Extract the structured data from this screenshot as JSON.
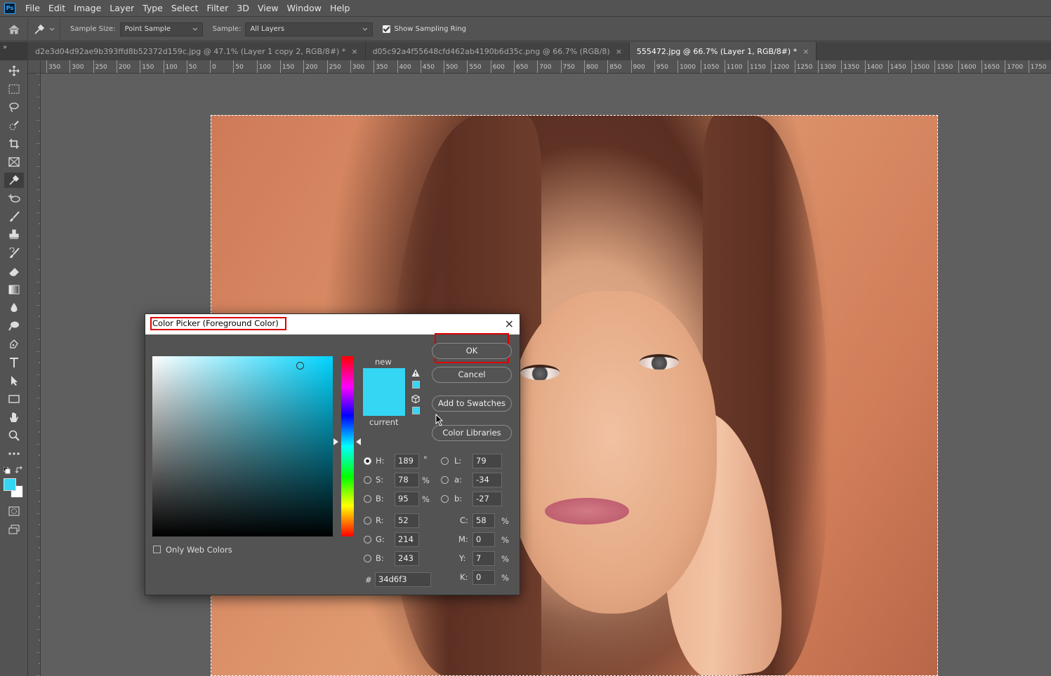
{
  "app": {
    "logo": "Ps"
  },
  "menu": [
    "File",
    "Edit",
    "Image",
    "Layer",
    "Type",
    "Select",
    "Filter",
    "3D",
    "View",
    "Window",
    "Help"
  ],
  "options": {
    "sample_size_label": "Sample Size:",
    "sample_size_value": "Point Sample",
    "sample_label": "Sample:",
    "sample_value": "All Layers",
    "show_ring_label": "Show Sampling Ring"
  },
  "tabs": {
    "collapse": "»",
    "items": [
      {
        "label": "d2e3d04d92ae9b393ffd8b52372d159c.jpg @ 47.1% (Layer 1 copy 2, RGB/8#) *",
        "close": "×"
      },
      {
        "label": "d05c92a4f55648cfd462ab4190b6d35c.png @ 66.7% (RGB/8)",
        "close": "×"
      },
      {
        "label": "555472.jpg @ 66.7% (Layer 1, RGB/8#) *",
        "close": "×"
      }
    ]
  },
  "ruler_top": [
    "350",
    "300",
    "250",
    "200",
    "150",
    "100",
    "50",
    "0",
    "50",
    "100",
    "150",
    "200",
    "250",
    "300",
    "350",
    "400",
    "450",
    "500",
    "550",
    "600",
    "650",
    "700",
    "750",
    "800",
    "850",
    "900",
    "950",
    "1000",
    "1050",
    "1100",
    "1150",
    "1200",
    "1250",
    "1300",
    "1350",
    "1400",
    "1450",
    "1500",
    "1550",
    "1600",
    "1650",
    "1700",
    "1750"
  ],
  "colors": {
    "foreground": "#34d6f3",
    "background": "#ffffff",
    "selected": "#34d6f3"
  },
  "dialog": {
    "title": "Color Picker (Foreground Color)",
    "close": "×",
    "new_label": "new",
    "current_label": "current",
    "buttons": {
      "ok": "OK",
      "cancel": "Cancel",
      "add_swatches": "Add to Swatches",
      "libraries": "Color Libraries"
    },
    "hsb": {
      "h_label": "H:",
      "h": "189",
      "h_unit": "°",
      "s_label": "S:",
      "s": "78",
      "s_unit": "%",
      "b_label": "B:",
      "b": "95",
      "b_unit": "%"
    },
    "lab": {
      "l_label": "L:",
      "l": "79",
      "a_label": "a:",
      "a": "-34",
      "b_label": "b:",
      "b": "-27"
    },
    "rgb": {
      "r_label": "R:",
      "r": "52",
      "g_label": "G:",
      "g": "214",
      "b_label": "B:",
      "b": "243"
    },
    "cmyk": {
      "c_label": "C:",
      "c": "58",
      "m_label": "M:",
      "m": "0",
      "y_label": "Y:",
      "y": "7",
      "k_label": "K:",
      "k": "0",
      "unit": "%"
    },
    "hex_label": "#",
    "hex": "34d6f3",
    "web_only_label": "Only Web Colors"
  }
}
